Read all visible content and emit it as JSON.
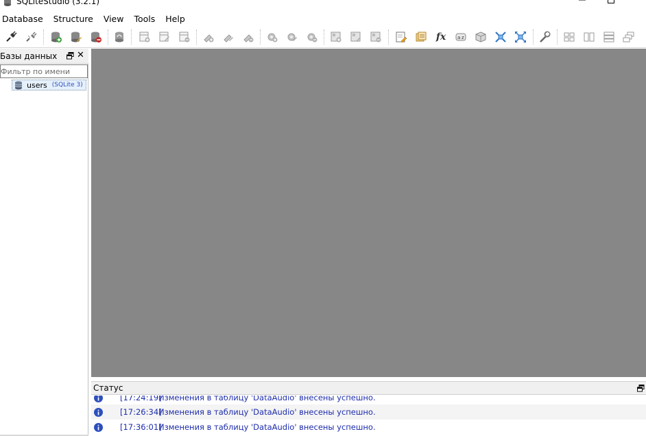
{
  "window": {
    "title": "SQLiteStudio (3.2.1)"
  },
  "menu": {
    "items": [
      "Database",
      "Structure",
      "View",
      "Tools",
      "Help"
    ]
  },
  "toolbar": {
    "buttons": [
      {
        "icon": "connect-icon"
      },
      {
        "icon": "disconnect-icon"
      },
      {
        "icon": "add-database-icon"
      },
      {
        "icon": "edit-database-icon"
      },
      {
        "icon": "remove-database-icon"
      },
      {
        "icon": "refresh-database-icon"
      },
      {
        "icon": "new-table-icon"
      },
      {
        "icon": "edit-table-icon"
      },
      {
        "icon": "delete-table-icon"
      },
      {
        "icon": "new-index-icon"
      },
      {
        "icon": "edit-index-icon"
      },
      {
        "icon": "delete-index-icon"
      },
      {
        "icon": "new-trigger-icon"
      },
      {
        "icon": "edit-trigger-icon"
      },
      {
        "icon": "delete-trigger-icon"
      },
      {
        "icon": "new-view-icon"
      },
      {
        "icon": "edit-view-icon"
      },
      {
        "icon": "delete-view-icon"
      },
      {
        "icon": "sql-editor-icon"
      },
      {
        "icon": "history-icon"
      },
      {
        "icon": "functions-icon"
      },
      {
        "icon": "collations-icon"
      },
      {
        "icon": "extensions-icon"
      },
      {
        "icon": "import-icon"
      },
      {
        "icon": "export-icon"
      },
      {
        "icon": "settings-wrench-icon"
      },
      {
        "icon": "tile-windows-icon"
      },
      {
        "icon": "tile-horizontal-icon"
      },
      {
        "icon": "tile-vertical-icon"
      },
      {
        "icon": "cascade-windows-icon"
      }
    ],
    "functions_label": "fx"
  },
  "databases_panel": {
    "title": "Базы данных",
    "close_glyph": "✕",
    "filter_placeholder": "Фильтр по имени",
    "items": [
      {
        "name": "users",
        "type": "(SQLite 3)"
      }
    ]
  },
  "status_panel": {
    "title": "Статус",
    "messages": [
      {
        "time": "[17:24:19]",
        "text": "Изменения в таблицу 'DataAudio' внесены успешно."
      },
      {
        "time": "[17:26:34]",
        "text": "Изменения в таблицу 'DataAudio' внесены успешно."
      },
      {
        "time": "[17:36:01]",
        "text": "Изменения в таблицу 'DataAudio' внесены успешно."
      }
    ]
  },
  "colors": {
    "mdi_background": "#878787",
    "status_text": "#1d2dab",
    "info_icon": "#2d4fbd"
  }
}
